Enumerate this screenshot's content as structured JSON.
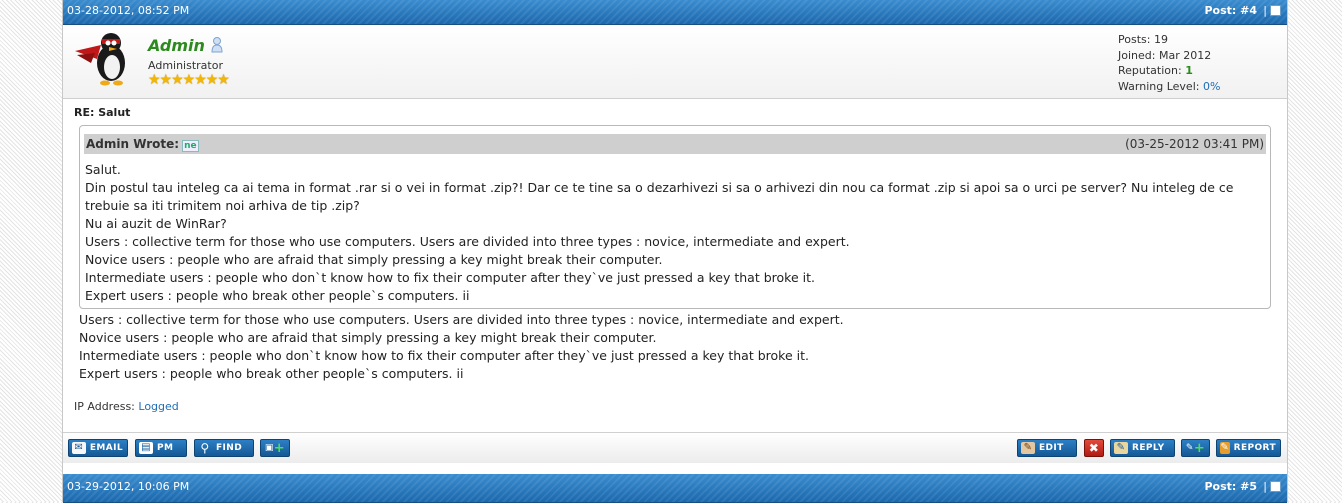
{
  "post_top": {
    "date": "03-28-2012, 08:52 PM",
    "post_label": "Post: #4",
    "separator": "|"
  },
  "author": {
    "name": "Admin",
    "role": "Administrator",
    "stars": "★★★★★★★",
    "posts_label": "Posts:",
    "posts": "19",
    "joined_label": "Joined:",
    "joined": "Mar 2012",
    "reputation_label": "Reputation:",
    "reputation": "1",
    "warning_label": "Warning Level:",
    "warning": "0%"
  },
  "post": {
    "subject": "RE: Salut",
    "quote": {
      "author_label": "Admin Wrote:",
      "badge": "ne",
      "date": "(03-25-2012 03:41 PM)",
      "lines": [
        "Salut.",
        "Din postul tau inteleg ca ai tema in format .rar si o vei in format .zip?! Dar ce te tine sa o dezarhivezi si sa o arhivezi din nou ca format .zip si apoi sa o urci pe server? Nu inteleg de ce trebuie sa iti trimitem noi arhiva de tip .zip?",
        "Nu ai auzit de WinRar?",
        "Users : collective term for those who use computers. Users are divided into three types : novice, intermediate and expert.",
        "Novice users : people who are afraid that simply pressing a key might break their computer.",
        "Intermediate users : people who don`t know how to fix their computer after they`ve just pressed a key that broke it.",
        "Expert users : people who break other people`s computers. ii"
      ]
    },
    "body_lines": [
      "Users : collective term for those who use computers. Users are divided into three types : novice, intermediate and expert.",
      "Novice users : people who are afraid that simply pressing a key might break their computer.",
      "Intermediate users : people who don`t know how to fix their computer after they`ve just pressed a key that broke it.",
      "Expert users : people who break other people`s computers. ii"
    ],
    "ip_label": "IP Address:",
    "ip_value": "Logged"
  },
  "buttons": {
    "email": "EMAIL",
    "pm": "PM",
    "find": "FIND",
    "edit": "EDIT",
    "reply": "REPLY",
    "report": "REPORT"
  },
  "post_bottom": {
    "date": "03-29-2012, 10:06 PM",
    "post_label": "Post: #5",
    "separator": "|"
  },
  "colors": {
    "bar_blue": "#1f6db3",
    "username_green": "#2c8a1e",
    "link_blue": "#1f6db3"
  }
}
